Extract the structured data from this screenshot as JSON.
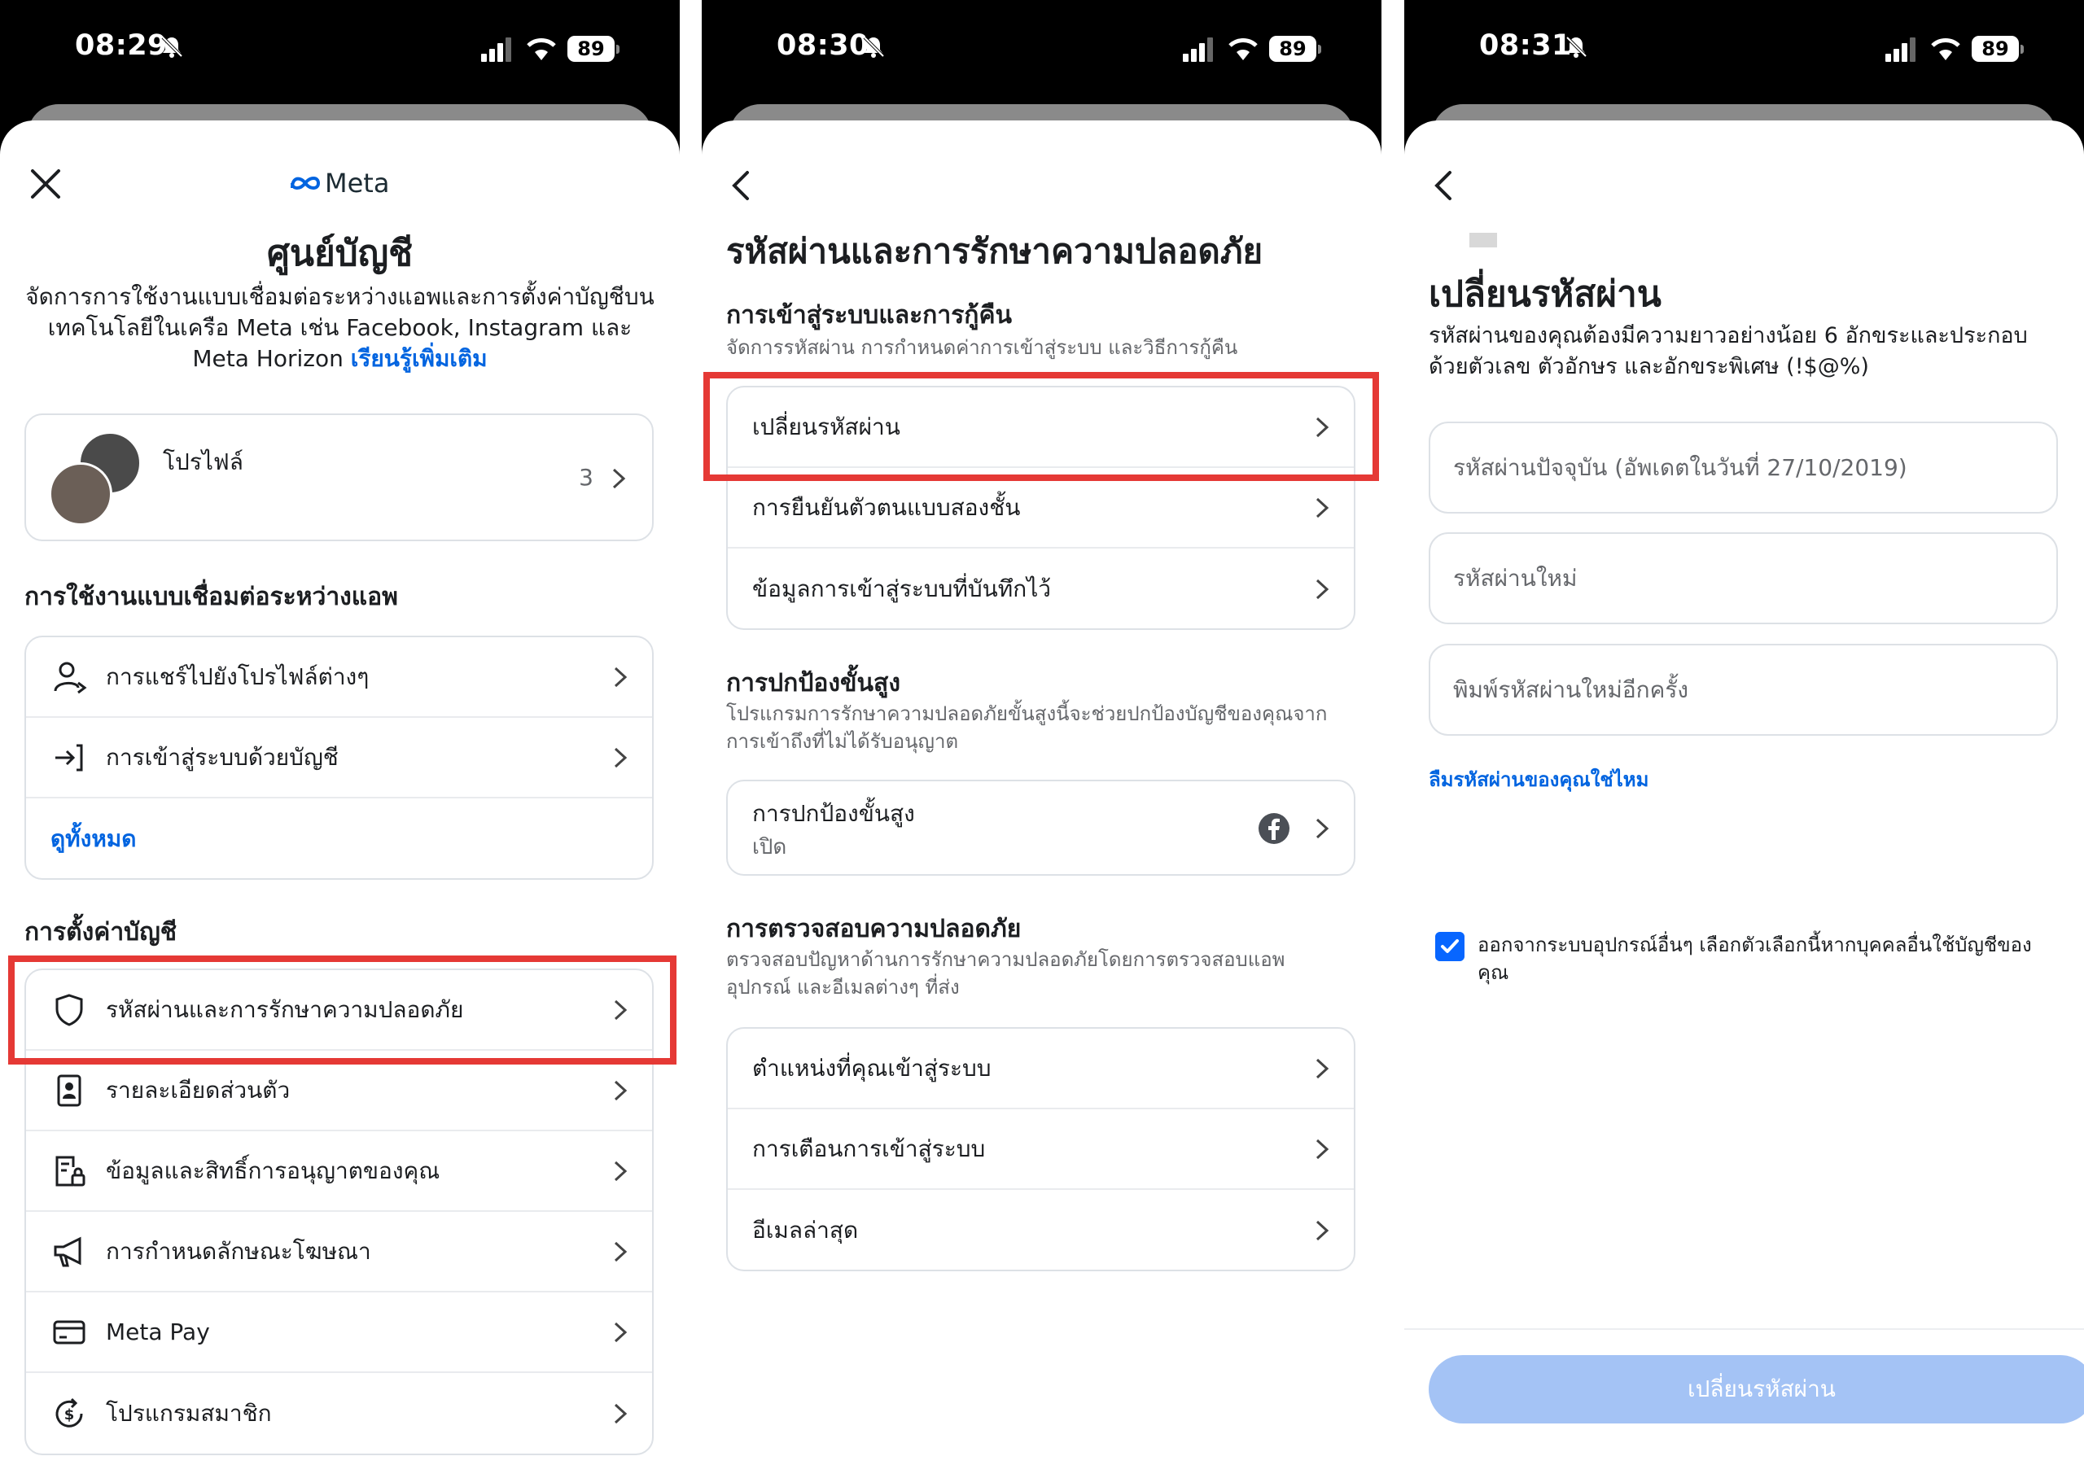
{
  "colors": {
    "accent": "#0064e0",
    "checkbox": "#0866ff",
    "highlight": "#e53935",
    "disabled_button": "#a4c3f5",
    "status_bar": "#000000"
  },
  "screens": [
    {
      "status": {
        "time": "08:29",
        "battery": "89"
      },
      "brand": "Meta",
      "title": "ศูนย์บัญชี",
      "description": "จัดการการใช้งานแบบเชื่อมต่อระหว่างแอพและการตั้งค่าบัญชีบนเทคโนโลยีในเครือ Meta เช่น Facebook, Instagram และ Meta Horizon",
      "learn_more": "เรียนรู้เพิ่มเติม",
      "profile": {
        "label": "โปรไฟล์",
        "count": "3"
      },
      "connected_heading": "การใช้งานแบบเชื่อมต่อระหว่างแอพ",
      "connected_items": [
        {
          "label": "การแชร์ไปยังโปรไฟล์ต่างๆ",
          "icon": "person-share-icon"
        },
        {
          "label": "การเข้าสู่ระบบด้วยบัญชี",
          "icon": "login-arrow-icon"
        }
      ],
      "see_all": "ดูทั้งหมด",
      "settings_heading": "การตั้งค่าบัญชี",
      "settings_items": [
        {
          "label": "รหัสผ่านและการรักษาความปลอดภัย",
          "icon": "shield-icon"
        },
        {
          "label": "รายละเอียดส่วนตัว",
          "icon": "id-card-icon"
        },
        {
          "label": "ข้อมูลและสิทธิ์การอนุญาตของคุณ",
          "icon": "document-lock-icon"
        },
        {
          "label": "การกำหนดลักษณะโฆษณา",
          "icon": "megaphone-icon"
        },
        {
          "label": "Meta Pay",
          "icon": "credit-card-icon"
        },
        {
          "label": "โปรแกรมสมาชิก",
          "icon": "dollar-cycle-icon"
        }
      ]
    },
    {
      "status": {
        "time": "08:30",
        "battery": "89"
      },
      "title": "รหัสผ่านและการรักษาความปลอดภัย",
      "login_heading": "การเข้าสู่ระบบและการกู้คืน",
      "login_sub": "จัดการรหัสผ่าน การกำหนดค่าการเข้าสู่ระบบ และวิธีการกู้คืน",
      "login_items": [
        {
          "label": "เปลี่ยนรหัสผ่าน"
        },
        {
          "label": "การยืนยันตัวตนแบบสองชั้น"
        },
        {
          "label": "ข้อมูลการเข้าสู่ระบบที่บันทึกไว้"
        }
      ],
      "advanced_heading": "การปกป้องขั้นสูง",
      "advanced_sub_1": "โปรแกรมการรักษาความปลอดภัยขั้นสูงนี้จะช่วยปกป้องบัญชีของคุณจาก",
      "advanced_sub_2": "การเข้าถึงที่ไม่ได้รับอนุญาต",
      "advanced_item": {
        "label": "การปกป้องขั้นสูง",
        "status": "เปิด"
      },
      "checks_heading": "การตรวจสอบความปลอดภัย",
      "checks_sub_1": "ตรวจสอบปัญหาด้านการรักษาความปลอดภัยโดยการตรวจสอบแอพ",
      "checks_sub_2": "อุปกรณ์ และอีเมลต่างๆ ที่ส่ง",
      "checks_items": [
        {
          "label": "ตำแหน่งที่คุณเข้าสู่ระบบ"
        },
        {
          "label": "การเตือนการเข้าสู่ระบบ"
        },
        {
          "label": "อีเมลล่าสุด"
        }
      ]
    },
    {
      "status": {
        "time": "08:31",
        "battery": "89"
      },
      "title": "เปลี่ยนรหัสผ่าน",
      "description_1": "รหัสผ่านของคุณต้องมีความยาวอย่างน้อย 6 อักขระและประกอบ",
      "description_2": "ด้วยตัวเลข ตัวอักษร และอักขระพิเศษ (!$@%)",
      "fields": [
        {
          "placeholder": "รหัสผ่านปัจจุบัน (อัพเดตในวันที่ 27/10/2019)"
        },
        {
          "placeholder": "รหัสผ่านใหม่"
        },
        {
          "placeholder": "พิมพ์รหัสผ่านใหม่อีกครั้ง"
        }
      ],
      "forgot": "ลืมรหัสผ่านของคุณใช่ไหม",
      "logout_other_1": "ออกจากระบบอุปกรณ์อื่นๆ เลือกตัวเลือกนี้หากบุคคลอื่นใช้บัญชีของ",
      "logout_other_2": "คุณ",
      "logout_checked": true,
      "submit": "เปลี่ยนรหัสผ่าน"
    }
  ]
}
